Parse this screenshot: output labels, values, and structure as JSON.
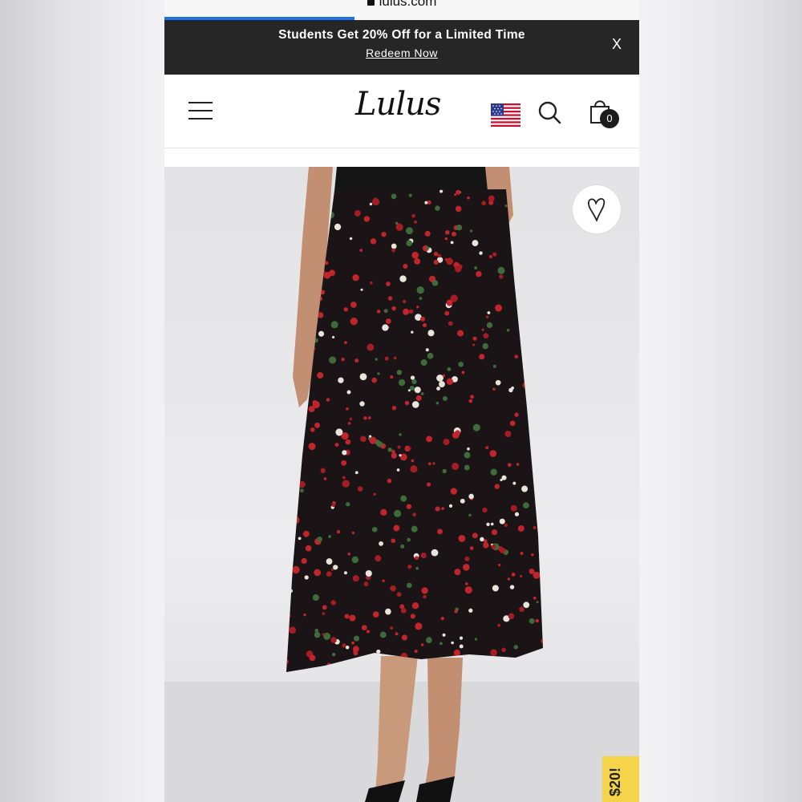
{
  "browser": {
    "url": "lulus.com",
    "progress": 0.4
  },
  "promo_banner": {
    "title": "Students Get 20% Off for a Limited Time",
    "link": "Redeem Now",
    "close": "X"
  },
  "header": {
    "logo": "Lulus",
    "cart_count": "0",
    "icons": [
      "menu-icon",
      "us-flag-icon",
      "search-icon",
      "shopping-bag-icon"
    ]
  },
  "product": {
    "image": "floral-midi-skirt-photo",
    "wishlist_icon": "heart-icon",
    "side_tab": "$20!",
    "colors": {
      "skirt": "#1a1416",
      "flower": "#c0252b",
      "tab": "#f5d44a"
    }
  }
}
